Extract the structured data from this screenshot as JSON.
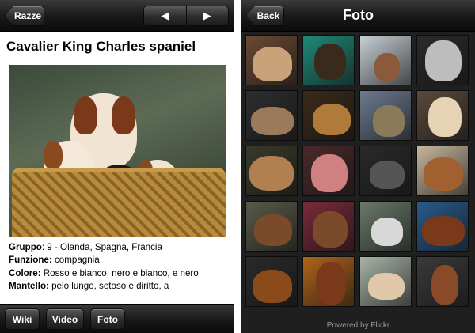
{
  "left": {
    "nav": {
      "back_label": "Razze",
      "prev_glyph": "◀",
      "next_glyph": "▶"
    },
    "title": "Cavalier King Charles spaniel",
    "info": {
      "group_key": "Gruppo",
      "group_value": ": 9 - Olanda, Spagna, Francia",
      "function_key": "Funzione:",
      "function_value": " compagnia",
      "color_key": "Colore:",
      "color_value": " Rosso e bianco, nero e bianco, e nero",
      "coat_key": "Mantello:",
      "coat_value": " pelo lungo, setoso e diritto, a"
    },
    "toolbar": {
      "wiki_label": "Wiki",
      "video_label": "Video",
      "foto_label": "Foto"
    }
  },
  "right": {
    "nav": {
      "back_label": "Back",
      "title": "Foto"
    },
    "footer": "Powered by Flickr",
    "thumbnails": [
      {
        "name": "thumb-1",
        "bg": "#6b4a33",
        "dog": "#c9a27a"
      },
      {
        "name": "thumb-2",
        "bg": "#1f8a79",
        "dog": "#3a2a1c"
      },
      {
        "name": "thumb-3",
        "bg": "#c8d0d6",
        "dog": "#8a5a3a"
      },
      {
        "name": "thumb-4",
        "bg": "#2b2b2b",
        "dog": "#bdbdbd"
      },
      {
        "name": "thumb-5",
        "bg": "#2e2e2e",
        "dog": "#9a7a5a"
      },
      {
        "name": "thumb-6",
        "bg": "#3b2a1a",
        "dog": "#b07a3a"
      },
      {
        "name": "thumb-7",
        "bg": "#6d7b8f",
        "dog": "#8a7a5a"
      },
      {
        "name": "thumb-8",
        "bg": "#5a4a3a",
        "dog": "#e6d2b4"
      },
      {
        "name": "thumb-9",
        "bg": "#3a3a2a",
        "dog": "#b08050"
      },
      {
        "name": "thumb-10",
        "bg": "#4a2a2a",
        "dog": "#d08080"
      },
      {
        "name": "thumb-11",
        "bg": "#2a2a2a",
        "dog": "#555555"
      },
      {
        "name": "thumb-12",
        "bg": "#c6b69c",
        "dog": "#a06030"
      },
      {
        "name": "thumb-13",
        "bg": "#5a5a4a",
        "dog": "#7a4a2a"
      },
      {
        "name": "thumb-14",
        "bg": "#7a2a3a",
        "dog": "#7a4a2a"
      },
      {
        "name": "thumb-15",
        "bg": "#6a7a6a",
        "dog": "#d8d8d8"
      },
      {
        "name": "thumb-16",
        "bg": "#2a5a8a",
        "dog": "#7a3a1a"
      },
      {
        "name": "thumb-17",
        "bg": "#2a2a2a",
        "dog": "#8a4a1a"
      },
      {
        "name": "thumb-18",
        "bg": "#b0641a",
        "dog": "#7a3a1a"
      },
      {
        "name": "thumb-19",
        "bg": "#a8b4a8",
        "dog": "#e0c8a8"
      },
      {
        "name": "thumb-20",
        "bg": "#3a3a3a",
        "dog": "#8a4a2a"
      }
    ]
  }
}
